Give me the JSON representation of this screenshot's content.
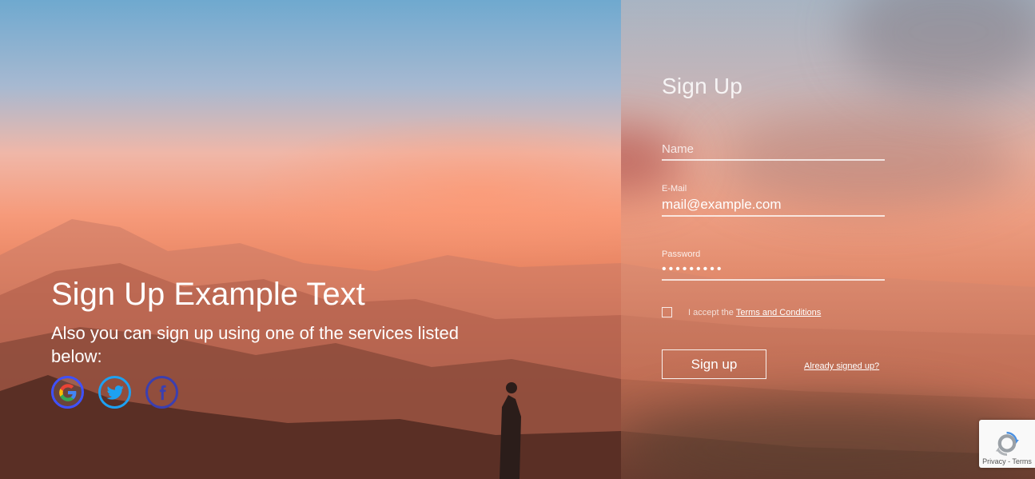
{
  "hero": {
    "title": "Sign Up Example Text",
    "subtitle": "Also you can sign up using one of the services listed below:",
    "social": [
      {
        "icon": "google-icon",
        "color": "#3f51ff"
      },
      {
        "icon": "twitter-icon",
        "color": "#1da1f2"
      },
      {
        "icon": "facebook-icon",
        "color": "#3b3fb0"
      }
    ]
  },
  "form": {
    "title": "Sign Up",
    "name": {
      "label": "",
      "placeholder": "Name",
      "value": ""
    },
    "email": {
      "label": "E-Mail",
      "value": "mail@example.com"
    },
    "password": {
      "label": "Password",
      "value": "•••••••••"
    },
    "terms_prefix": "I accept the",
    "terms_link": "Terms and Conditions",
    "submit_label": "Sign up",
    "already_link": "Already signed up?"
  },
  "recaptcha": {
    "text": "Privacy - Terms"
  }
}
